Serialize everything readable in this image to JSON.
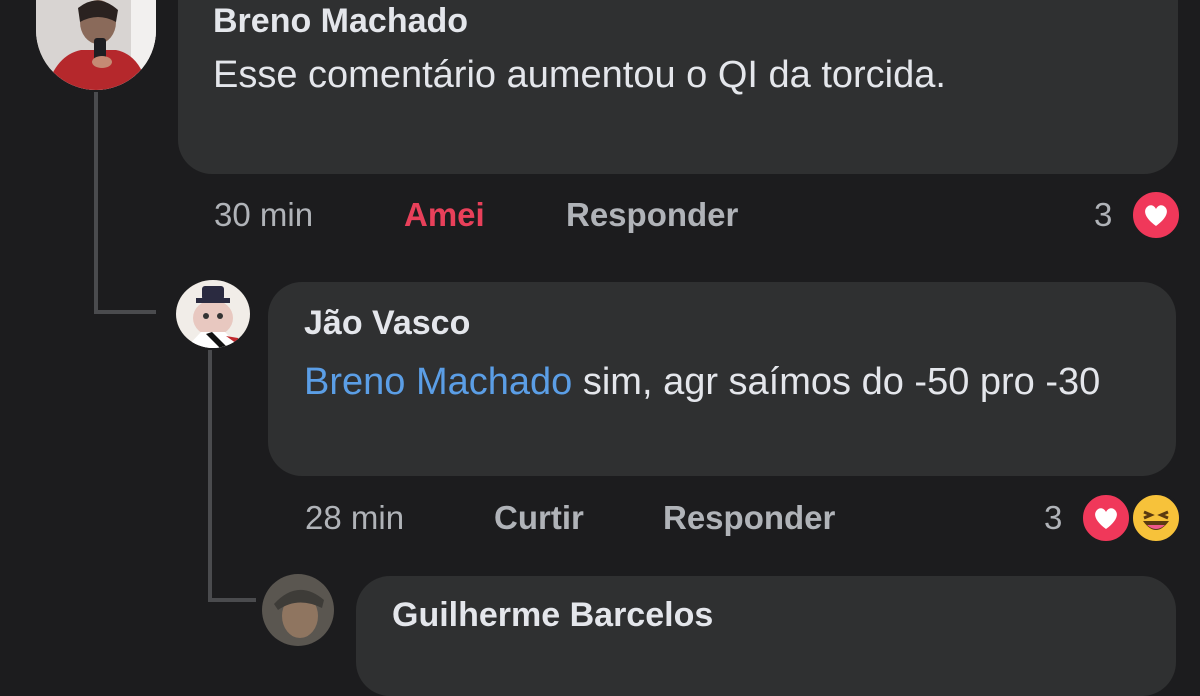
{
  "colors": {
    "background": "#1c1c1e",
    "bubble": "#2f3031",
    "mention": "#5b9ee6",
    "loved": "#e8405a",
    "meta": "#b0b3b8"
  },
  "comments": [
    {
      "author": "Breno Machado",
      "text": "Esse comentário aumentou o QI da torcida.",
      "time": "30 min",
      "like_label": "Amei",
      "reply_label": "Responder",
      "reaction_count": "3",
      "reactions": [
        "heart-icon"
      ]
    },
    {
      "author": "Jão Vasco",
      "mention": "Breno Machado",
      "text": " sim, agr saímos do -50 pro -30",
      "time": "28 min",
      "like_label": "Curtir",
      "reply_label": "Responder",
      "reaction_count": "3",
      "reactions": [
        "heart-icon",
        "laughing-emoji-icon"
      ]
    },
    {
      "author": "Guilherme Barcelos"
    }
  ]
}
